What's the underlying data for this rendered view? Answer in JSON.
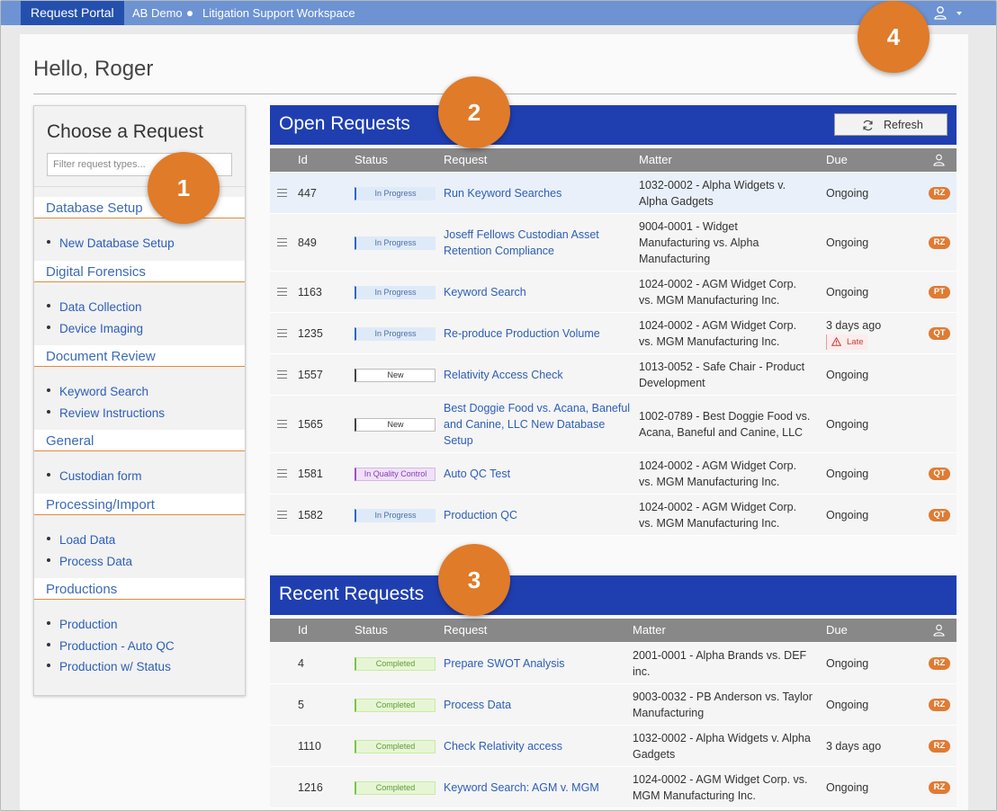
{
  "topbar": {
    "brand": "Request Portal",
    "org": "AB Demo",
    "workspace": "Litigation Support Workspace",
    "user_icon": "user-icon"
  },
  "greeting": "Hello, Roger",
  "choose": {
    "title": "Choose a Request",
    "filter_placeholder": "Filter request types...",
    "categories": [
      {
        "name": "Database Setup",
        "items": [
          "New Database Setup"
        ]
      },
      {
        "name": "Digital Forensics",
        "items": [
          "Data Collection",
          "Device Imaging"
        ]
      },
      {
        "name": "Document Review",
        "items": [
          "Keyword Search",
          "Review Instructions"
        ]
      },
      {
        "name": "General",
        "items": [
          "Custodian form"
        ]
      },
      {
        "name": "Processing/Import",
        "items": [
          "Load Data",
          "Process Data"
        ]
      },
      {
        "name": "Productions",
        "items": [
          "Production",
          "Production - Auto QC",
          "Production w/ Status"
        ]
      }
    ]
  },
  "open": {
    "title": "Open Requests",
    "refresh_label": "Refresh",
    "columns": {
      "id": "Id",
      "status": "Status",
      "request": "Request",
      "matter": "Matter",
      "due": "Due"
    },
    "rows": [
      {
        "id": "447",
        "status": "In Progress",
        "request": [
          "Run Keyword Searches"
        ],
        "matter": [
          "1032-0002 - Alpha Widgets v.",
          "Alpha Gadgets"
        ],
        "due": "Ongoing",
        "assignee": "RZ"
      },
      {
        "id": "849",
        "status": "In Progress",
        "request": [
          "Joseff Fellows Custodian Asset",
          "Retention Compliance"
        ],
        "matter": [
          "9004-0001 - Widget",
          "Manufacturing vs. Alpha",
          "Manufacturing"
        ],
        "due": "Ongoing",
        "assignee": "RZ"
      },
      {
        "id": "1163",
        "status": "In Progress",
        "request": [
          "Keyword Search"
        ],
        "matter": [
          "1024-0002 - AGM Widget Corp.",
          "vs. MGM Manufacturing Inc."
        ],
        "due": "Ongoing",
        "assignee": "PT"
      },
      {
        "id": "1235",
        "status": "In Progress",
        "request": [
          "Re-produce Production Volume"
        ],
        "matter": [
          "1024-0002 - AGM Widget Corp.",
          "vs. MGM Manufacturing Inc."
        ],
        "due": "3 days ago",
        "late": "Late",
        "assignee": "QT"
      },
      {
        "id": "1557",
        "status": "New",
        "request": [
          "Relativity Access Check"
        ],
        "matter": [
          "1013-0052 - Safe Chair - Product",
          "Development"
        ],
        "due": "Ongoing",
        "assignee": ""
      },
      {
        "id": "1565",
        "status": "New",
        "request": [
          "Best Doggie Food vs. Acana, Baneful",
          "and Canine, LLC New Database",
          "Setup"
        ],
        "matter": [
          "1002-0789 - Best Doggie Food vs.",
          "Acana, Baneful and Canine, LLC"
        ],
        "due": "Ongoing",
        "assignee": ""
      },
      {
        "id": "1581",
        "status": "In Quality Control",
        "request": [
          "Auto QC Test"
        ],
        "matter": [
          "1024-0002 - AGM Widget Corp.",
          "vs. MGM Manufacturing Inc."
        ],
        "due": "Ongoing",
        "assignee": "QT"
      },
      {
        "id": "1582",
        "status": "In Progress",
        "request": [
          "Production QC"
        ],
        "matter": [
          "1024-0002 - AGM Widget Corp.",
          "vs. MGM Manufacturing Inc."
        ],
        "due": "Ongoing",
        "assignee": "QT"
      }
    ]
  },
  "recent": {
    "title": "Recent Requests",
    "columns": {
      "id": "Id",
      "status": "Status",
      "request": "Request",
      "matter": "Matter",
      "due": "Due"
    },
    "rows": [
      {
        "id": "4",
        "status": "Completed",
        "request": [
          "Prepare SWOT Analysis"
        ],
        "matter": [
          "2001-0001 - Alpha Brands vs. DEF",
          "inc."
        ],
        "due": "Ongoing",
        "assignee": "RZ"
      },
      {
        "id": "5",
        "status": "Completed",
        "request": [
          "Process Data"
        ],
        "matter": [
          "9003-0032 - PB Anderson vs. Taylor",
          "Manufacturing"
        ],
        "due": "Ongoing",
        "assignee": "RZ"
      },
      {
        "id": "1110",
        "status": "Completed",
        "request": [
          "Check Relativity access"
        ],
        "matter": [
          "1032-0002 - Alpha Widgets v. Alpha",
          "Gadgets"
        ],
        "due": "3 days ago",
        "assignee": "RZ"
      },
      {
        "id": "1216",
        "status": "Completed",
        "request": [
          "Keyword Search: AGM v. MGM"
        ],
        "matter": [
          "1024-0002 - AGM Widget Corp. vs.",
          "MGM Manufacturing Inc."
        ],
        "due": "Ongoing",
        "assignee": "RZ"
      }
    ]
  },
  "callouts": [
    "1",
    "2",
    "3",
    "4"
  ],
  "colors": {
    "topbar": "#6d93d3",
    "brand": "#2450ad",
    "section_header": "#1f3fb1",
    "accent": "#e07b29",
    "link": "#2d5eb8"
  }
}
